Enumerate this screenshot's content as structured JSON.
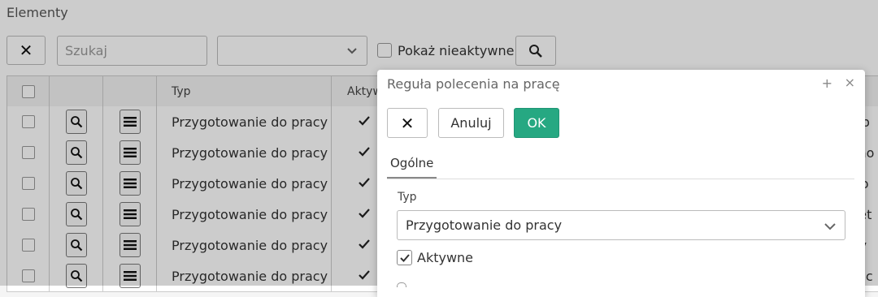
{
  "page": {
    "title": "Elementy",
    "clear_button": "✕",
    "search_placeholder": "Szukaj",
    "filter_select_value": "",
    "show_inactive_label": "Pokaż nieaktywne"
  },
  "grid": {
    "columns": {
      "type": "Typ",
      "active": "Aktyw"
    },
    "rows": [
      {
        "type": "Przygotowanie do pracy",
        "active": true,
        "tail": "ab"
      },
      {
        "type": "Przygotowanie do pracy",
        "active": true,
        "tail": "mo"
      },
      {
        "type": "Przygotowanie do pracy",
        "active": true,
        "tail": "ko"
      },
      {
        "type": "Przygotowanie do pracy",
        "active": true,
        "tail": "ret"
      },
      {
        "type": "Przygotowanie do pracy",
        "active": true,
        "tail": "ry"
      },
      {
        "type": "Przygotowanie do pracy",
        "active": true,
        "tail": "a c"
      }
    ]
  },
  "dialog": {
    "title": "Reguła polecenia na pracę",
    "maximize_glyph": "+",
    "close_glyph": "×",
    "clear_button": "✕",
    "cancel_button": "Anuluj",
    "ok_button": "OK",
    "tabs": [
      "Ogólne"
    ],
    "type_label": "Typ",
    "type_value": "Przygotowanie do pracy",
    "active_label": "Aktywne",
    "active_checked": true
  },
  "colors": {
    "ok_button": "#26a882",
    "overlay": "rgba(0,0,0,0.2)"
  }
}
